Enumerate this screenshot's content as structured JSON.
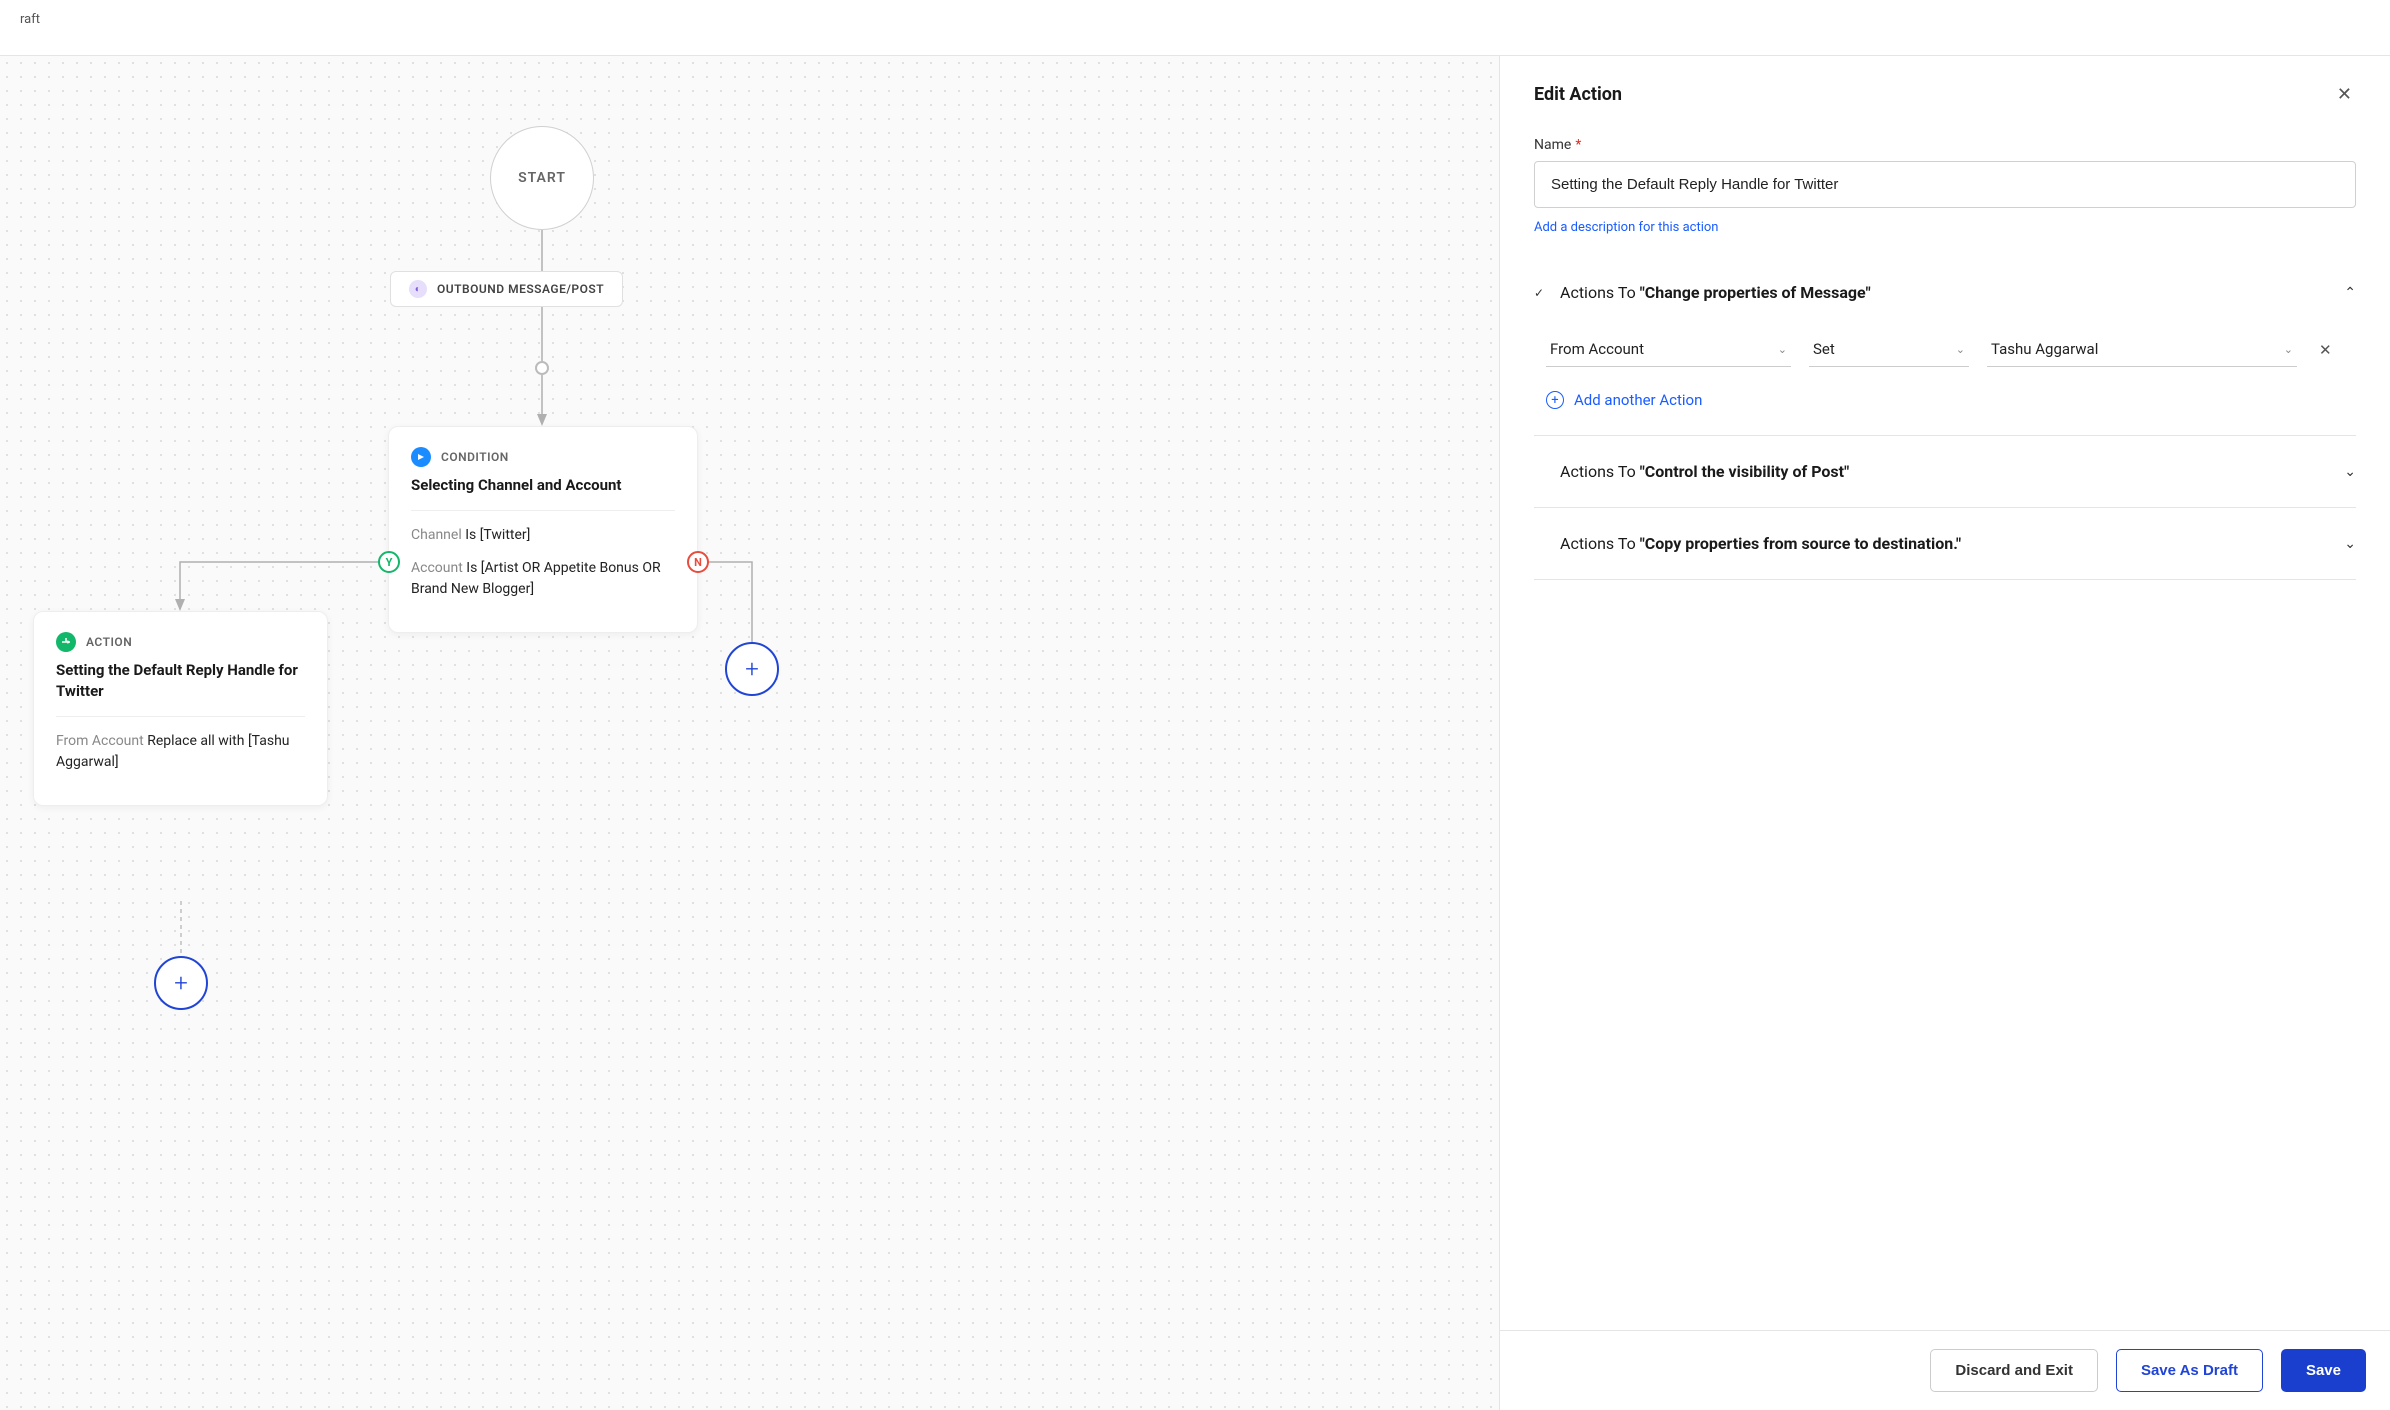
{
  "top": {
    "draft_label": "raft"
  },
  "canvas": {
    "start": "START",
    "trigger_pill": "OUTBOUND MESSAGE/POST",
    "condition": {
      "type_label": "CONDITION",
      "title": "Selecting Channel and Account",
      "rule1_left": "Channel",
      "rule1_right": "Is [Twitter]",
      "rule2_left": "Account",
      "rule2_right": "Is [Artist OR Appetite Bonus OR Brand New Blogger]"
    },
    "branch_yes": "Y",
    "branch_no": "N",
    "action": {
      "type_label": "ACTION",
      "title": "Setting the Default Reply Handle for Twitter",
      "rule_left": "From Account",
      "rule_right": "Replace all with [Tashu Aggarwal]"
    }
  },
  "panel": {
    "heading": "Edit Action",
    "name_label": "Name",
    "name_value": "Setting the Default Reply Handle for Twitter",
    "add_description": "Add a description for this action",
    "sections": {
      "s1_prefix": "Actions To ",
      "s1_bold": "\"Change properties of Message\"",
      "s2_prefix": "Actions To ",
      "s2_bold": "\"Control the visibility of Post\"",
      "s3_prefix": "Actions To ",
      "s3_bold": "\"Copy properties from source to destination.\""
    },
    "rule_row": {
      "property": "From Account",
      "operation": "Set",
      "value": "Tashu Aggarwal"
    },
    "add_another": "Add another Action"
  },
  "footer": {
    "discard": "Discard and Exit",
    "draft": "Save As Draft",
    "save": "Save"
  }
}
